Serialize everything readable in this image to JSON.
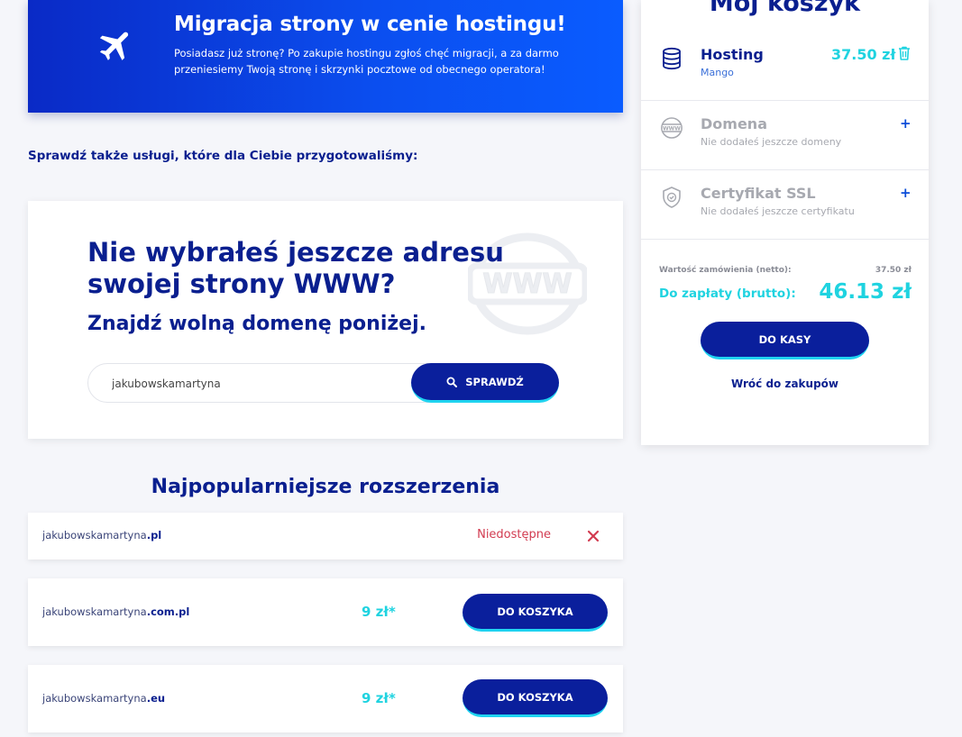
{
  "banner": {
    "title": "Migracja strony w cenie hostingu!",
    "text": "Posiadasz już stronę? Po zakupie hostingu zgłoś chęć migracji, a za darmo przeniesiemy Twoją stronę i skrzynki pocztowe od obecnego operatora!",
    "icon": "airplane-icon"
  },
  "also_heading": "Sprawdź także usługi, które dla Ciebie przygotowaliśmy:",
  "search": {
    "title": "Nie wybrałeś jeszcze adresu swojej strony WWW?",
    "subtitle": "Znajdź wolną domenę poniżej.",
    "value": "jakubowskamartyna",
    "button_label": "SPRAWDŹ",
    "background_icon": "www-globe-icon"
  },
  "popular": {
    "title": "Najpopularniejsze rozszerzenia",
    "rows": [
      {
        "name": "jakubowskamartyna",
        "ext": ".pl",
        "status": "Niedostępne",
        "available": false
      },
      {
        "name": "jakubowskamartyna",
        "ext": ".com.pl",
        "price": "9 zł*",
        "button": "DO KOSZYKA",
        "available": true
      },
      {
        "name": "jakubowskamartyna",
        "ext": ".eu",
        "price": "9 zł*",
        "button": "DO KOSZYKA",
        "available": true
      }
    ]
  },
  "cart": {
    "title": "Mój koszyk",
    "items": [
      {
        "name": "Hosting",
        "sub": "Mango",
        "amount": "37.50 zł",
        "icon": "database-icon"
      },
      {
        "name": "Domena",
        "sub": "Nie dodałeś jeszcze domeny",
        "icon": "www-icon",
        "action": "+"
      },
      {
        "name": "Certyfikat SSL",
        "sub": "Nie dodałeś jeszcze certyfikatu",
        "icon": "shield-check-icon",
        "action": "+"
      }
    ],
    "net_label": "Wartość zamówienia (netto):",
    "net_value": "37.50 zł",
    "gross_label": "Do zapłaty (brutto):",
    "gross_value": "46.13 zł",
    "checkout_label": "DO KASY",
    "back_label": "Wróć do zakupów"
  },
  "colors": {
    "primary": "#0a1f9c",
    "accent": "#1fd3e0",
    "danger": "#d23b50"
  }
}
